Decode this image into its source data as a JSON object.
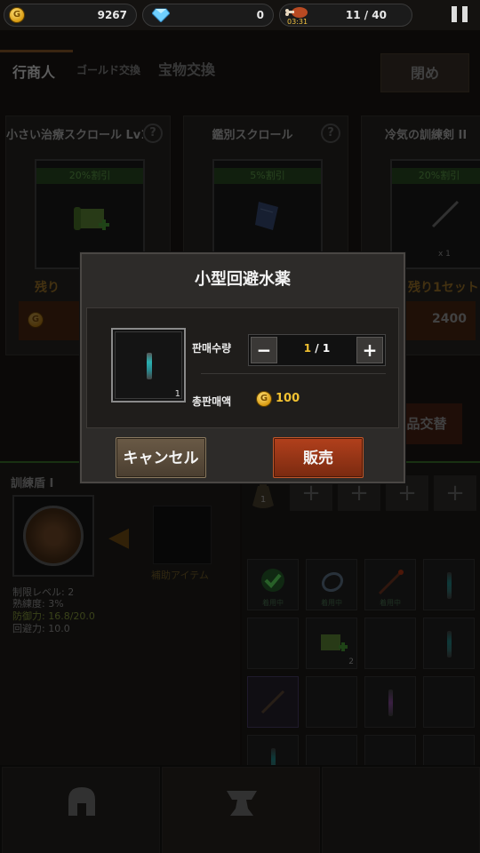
{
  "topbar": {
    "gold": "9267",
    "gems": "0",
    "stamina": "11 / 40",
    "stamina_timer": "03:31"
  },
  "shop": {
    "tabs": [
      "行商人",
      "ゴールド交換",
      "宝物交換"
    ],
    "close_label": "閉め",
    "cards": [
      {
        "title": "小さい治療スクロール Lv1",
        "discount": "20%割引",
        "remain": "残り",
        "price": ""
      },
      {
        "title": "鑑別スクロール",
        "discount": "5%割引",
        "remain": "",
        "price": ""
      },
      {
        "title": "冷気の訓練剣 II",
        "discount": "20%割引",
        "remain": "残り1セット",
        "qty": "x 1",
        "price": "2400"
      }
    ],
    "exchange_label": "品交替"
  },
  "craft": {
    "item_name": "訓練盾 I",
    "aux_label": "補助アイテム",
    "stats": [
      "制限レベル: 2",
      "熟練度: 3%",
      "防御力: 16.8/20.0",
      "回避力: 10.0"
    ]
  },
  "inventory": {
    "bag_count": "1",
    "equipped_label": "着用中",
    "stack_count": "2"
  },
  "bottom_nav": {
    "equip": "装備",
    "synth": "合成"
  },
  "modal": {
    "title": "小型回避水薬",
    "item_count": "1",
    "qty_label": "판매수량",
    "qty_current": "1",
    "qty_total": "1",
    "minus": "−",
    "plus": "+",
    "total_label": "총판매액",
    "total_value": "100",
    "cancel_label": "キャンセル",
    "sell_label": "販売"
  },
  "colors": {
    "gold": "#f2c232",
    "sell_button": "#a23a18",
    "cancel_button": "#5a4c3a"
  }
}
